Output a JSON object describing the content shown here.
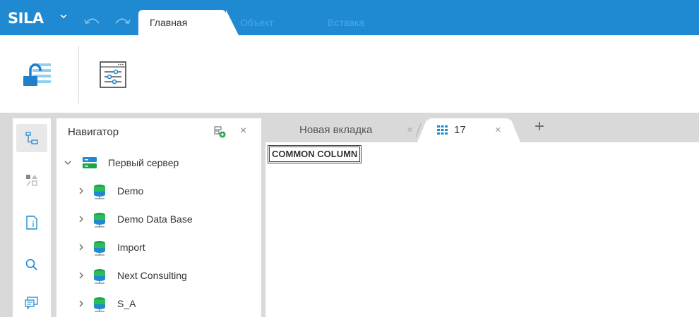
{
  "app": {
    "logo": "SILA",
    "ribbon_tabs": [
      {
        "label": "Главная",
        "active": true
      },
      {
        "label": "Объект",
        "active": false
      },
      {
        "label": "Вставка",
        "active": false
      }
    ],
    "accent_color": "#1f8ad2"
  },
  "toolbar": {
    "buttons": [
      {
        "icon": "unlock-icon"
      },
      {
        "icon": "settings-sliders-icon"
      }
    ]
  },
  "leftbar": {
    "items": [
      {
        "icon": "tree-structure-icon",
        "active": true
      },
      {
        "icon": "shapes-icon",
        "active": false
      },
      {
        "icon": "document-info-icon",
        "active": false
      },
      {
        "icon": "search-icon",
        "active": false
      },
      {
        "icon": "chat-icon",
        "active": false
      }
    ]
  },
  "navigator": {
    "title": "Навигатор",
    "close": "×",
    "server": {
      "label": "Первый сервер",
      "expanded": true
    },
    "databases": [
      {
        "label": "Demo"
      },
      {
        "label": "Demo Data Base"
      },
      {
        "label": "Import"
      },
      {
        "label": "Next Consulting"
      },
      {
        "label": "S_A"
      }
    ]
  },
  "doc_tabs": [
    {
      "label": "Новая вкладка",
      "close": "×"
    },
    {
      "label": "17",
      "close": "×",
      "active": true
    }
  ],
  "add_tab": "+",
  "content": {
    "cell_text": "COMMON COLUMN"
  }
}
